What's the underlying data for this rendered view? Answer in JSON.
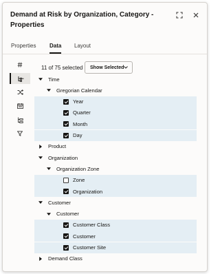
{
  "header": {
    "title": "Demand at Risk by Organization, Category - Properties",
    "icons": [
      "expand-icon",
      "close-icon"
    ]
  },
  "tabs": [
    {
      "label": "Properties",
      "active": false
    },
    {
      "label": "Data",
      "active": true
    },
    {
      "label": "Layout",
      "active": false
    }
  ],
  "rail": [
    "hash-icon",
    "hierarchy-icon",
    "shuffle-icon",
    "calendar-icon",
    "tree-icon",
    "filter-icon"
  ],
  "selection": {
    "count_text": "11 of 75 selected",
    "button_label": "Show Selected"
  },
  "tree": [
    {
      "label": "Time",
      "level": 0,
      "type": "expanded"
    },
    {
      "label": "Gregorian Calendar",
      "level": 1,
      "type": "expanded"
    },
    {
      "label": "Year",
      "level": 2,
      "type": "checked"
    },
    {
      "label": "Quarter",
      "level": 2,
      "type": "checked"
    },
    {
      "label": "Month",
      "level": 2,
      "type": "checked"
    },
    {
      "label": "Day",
      "level": 2,
      "type": "checked"
    },
    {
      "label": "Product",
      "level": 0,
      "type": "collapsed"
    },
    {
      "label": "Organization",
      "level": 0,
      "type": "expanded"
    },
    {
      "label": "Organization Zone",
      "level": 1,
      "type": "expanded"
    },
    {
      "label": "Zone",
      "level": 2,
      "type": "unchecked"
    },
    {
      "label": "Organization",
      "level": 2,
      "type": "checked"
    },
    {
      "label": "Customer",
      "level": 0,
      "type": "expanded"
    },
    {
      "label": "Customer",
      "level": 1,
      "type": "expanded"
    },
    {
      "label": "Customer Class",
      "level": 2,
      "type": "checked"
    },
    {
      "label": "Customer",
      "level": 2,
      "type": "checked"
    },
    {
      "label": "Customer Site",
      "level": 2,
      "type": "checked"
    },
    {
      "label": "Demand Class",
      "level": 0,
      "type": "collapsed"
    }
  ]
}
